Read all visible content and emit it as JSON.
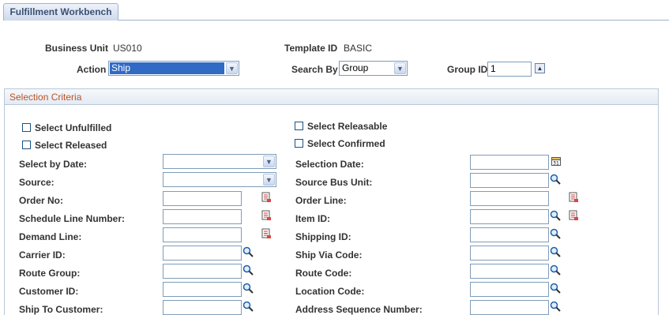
{
  "tab": {
    "label": "Fulfillment Workbench"
  },
  "header": {
    "business_unit_label": "Business Unit",
    "business_unit_value": "US010",
    "template_id_label": "Template ID",
    "template_id_value": "BASIC",
    "action_label": "Action",
    "action_value": "Ship",
    "search_by_label": "Search By",
    "search_by_value": "Group",
    "group_id_label": "Group ID",
    "group_id_value": "1"
  },
  "section": {
    "title": "Selection Criteria"
  },
  "checkboxes": {
    "select_unfulfilled": "Select Unfulfilled",
    "select_releasable": "Select Releasable",
    "select_released": "Select Released",
    "select_confirmed": "Select Confirmed"
  },
  "fields": {
    "select_by_date": "Select by Date:",
    "source": "Source:",
    "order_no": "Order No:",
    "schedule_line_number": "Schedule Line Number:",
    "demand_line": "Demand Line:",
    "carrier_id": "Carrier ID:",
    "route_group": "Route Group:",
    "customer_id": "Customer ID:",
    "ship_to_customer": "Ship To Customer:",
    "selection_date": "Selection Date:",
    "source_bus_unit": "Source Bus Unit:",
    "order_line": "Order Line:",
    "item_id": "Item ID:",
    "shipping_id": "Shipping ID:",
    "ship_via_code": "Ship Via Code:",
    "route_code": "Route Code:",
    "location_code": "Location Code:",
    "address_sequence_number": "Address Sequence Number:"
  },
  "icons": {
    "lookup": "magnifier-icon",
    "detail": "document-list-icon",
    "calendar": "calendar-icon",
    "dropdown": "chevron-down-icon",
    "up": "up-arrow-icon"
  },
  "colors": {
    "section_title": "#b8532a",
    "tab_text": "#3b4f73",
    "selection_highlight": "#316ac5"
  }
}
